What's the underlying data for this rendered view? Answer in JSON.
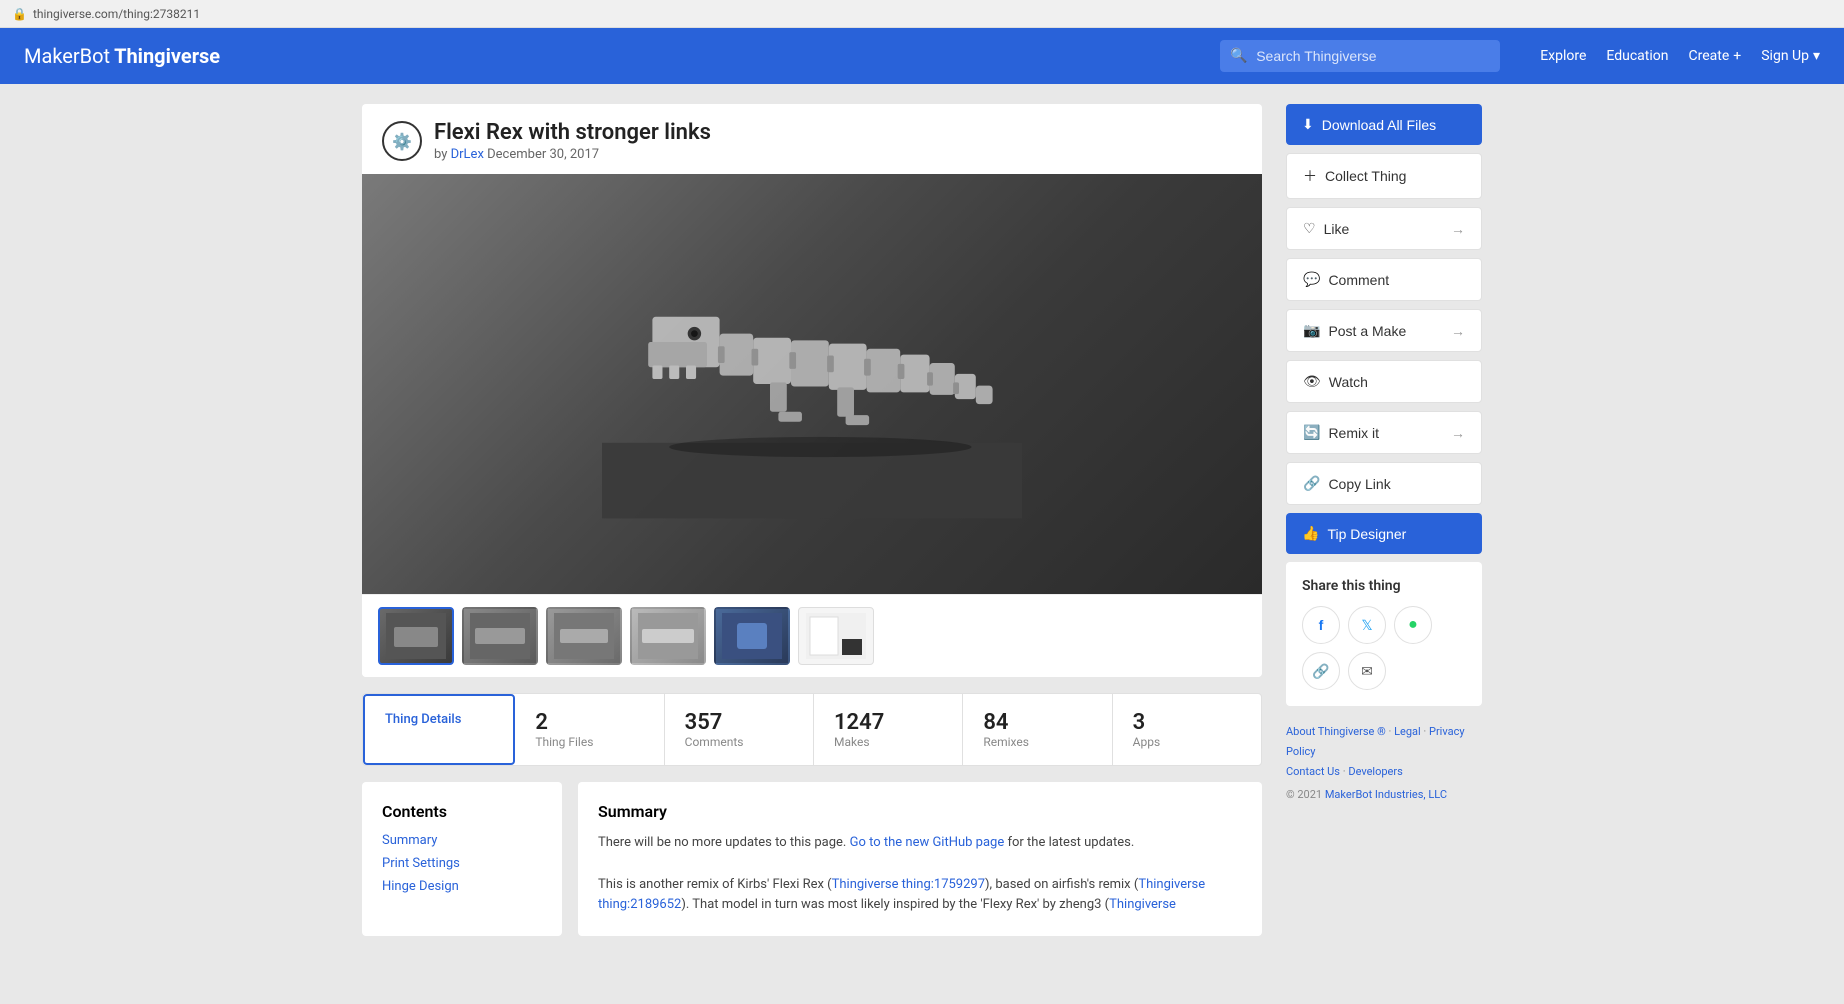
{
  "browser": {
    "url": "thingiverse.com/thing:2738211"
  },
  "navbar": {
    "logo_makerbot": "MakerBot",
    "logo_thingiverse": "Thingiverse",
    "search_placeholder": "Search Thingiverse",
    "explore_label": "Explore",
    "education_label": "Education",
    "create_label": "Create",
    "signup_label": "Sign Up"
  },
  "thing": {
    "title": "Flexi Rex with stronger links",
    "author": "DrLex",
    "date": "December 30, 2017"
  },
  "thumbnails": [
    {
      "id": 1,
      "label": "thumb1",
      "active": true
    },
    {
      "id": 2,
      "label": "thumb2",
      "active": false
    },
    {
      "id": 3,
      "label": "thumb3",
      "active": false
    },
    {
      "id": 4,
      "label": "thumb4",
      "active": false
    },
    {
      "id": 5,
      "label": "thumb5",
      "active": false
    },
    {
      "id": 6,
      "label": "thumb6",
      "active": false
    }
  ],
  "stats": [
    {
      "label": "Thing Details",
      "count": null,
      "tab_type": "details"
    },
    {
      "label": "Thing Files",
      "count": "2",
      "tab_type": "files"
    },
    {
      "label": "Comments",
      "count": "357",
      "tab_type": "comments"
    },
    {
      "label": "Makes",
      "count": "1247",
      "tab_type": "makes"
    },
    {
      "label": "Remixes",
      "count": "84",
      "tab_type": "remixes"
    },
    {
      "label": "Apps",
      "count": "3",
      "tab_type": "apps"
    }
  ],
  "sidebar": {
    "download_label": "Download All Files",
    "collect_label": "Collect Thing",
    "like_label": "Like",
    "comment_label": "Comment",
    "post_make_label": "Post a Make",
    "watch_label": "Watch",
    "remix_label": "Remix it",
    "copy_link_label": "Copy Link",
    "tip_label": "Tip Designer",
    "share_title": "Share this thing"
  },
  "contents": {
    "title": "Contents",
    "links": [
      {
        "label": "Summary"
      },
      {
        "label": "Print Settings"
      },
      {
        "label": "Hinge Design"
      }
    ]
  },
  "summary": {
    "title": "Summary",
    "notice": "There will be no more updates to this page.",
    "github_link": "Go to the new GitHub page",
    "github_suffix": " for the latest updates.",
    "body": "This is another remix of Kirbs' Flexi Rex (Thingiverse thing:1759297), based on airfish's remix (Thingiverse thing:2189652). That model in turn was most likely inspired by the 'Flexy Rex' by zheng3 (Thingiverse"
  },
  "footer": {
    "about": "About Thingiverse ®",
    "legal": "Legal",
    "privacy": "Privacy Policy",
    "contact": "Contact Us",
    "developers": "Developers",
    "copyright": "© 2021 MakerBot Industries, LLC"
  },
  "colors": {
    "primary": "#2962d9",
    "text": "#333",
    "muted": "#888"
  }
}
